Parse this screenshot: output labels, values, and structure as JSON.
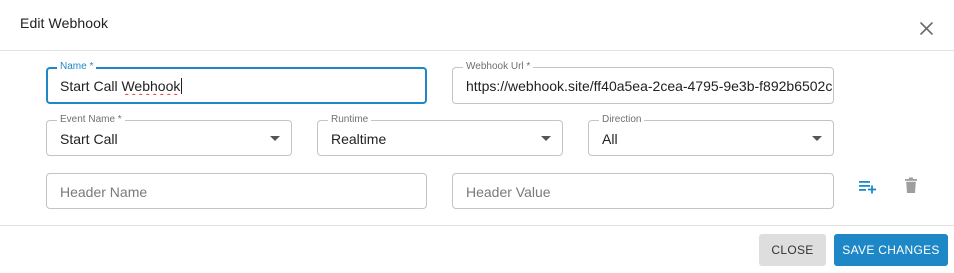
{
  "dialog": {
    "title": "Edit Webhook"
  },
  "form": {
    "name": {
      "label": "Name *",
      "value_prefix": "Start Call ",
      "value_misspelled": "Webhook"
    },
    "webhook_url": {
      "label": "Webhook Url *",
      "value": "https://webhook.site/ff40a5ea-2cea-4795-9e3b-f892b6502c"
    },
    "event_name": {
      "label": "Event Name *",
      "value": "Start Call"
    },
    "runtime": {
      "label": "Runtime",
      "value": "Realtime"
    },
    "direction": {
      "label": "Direction",
      "value": "All"
    },
    "header_name": {
      "placeholder": "Header Name"
    },
    "header_value": {
      "placeholder": "Header Value"
    }
  },
  "icons": {
    "close": "close-icon",
    "add_header": "playlist-add-icon",
    "delete_header": "trash-icon"
  },
  "colors": {
    "accent": "#1e88c7",
    "close_button_bg": "#dedede",
    "icon_gray": "#9e9e9e"
  },
  "footer": {
    "close_label": "CLOSE",
    "save_label": "SAVE CHANGES"
  }
}
